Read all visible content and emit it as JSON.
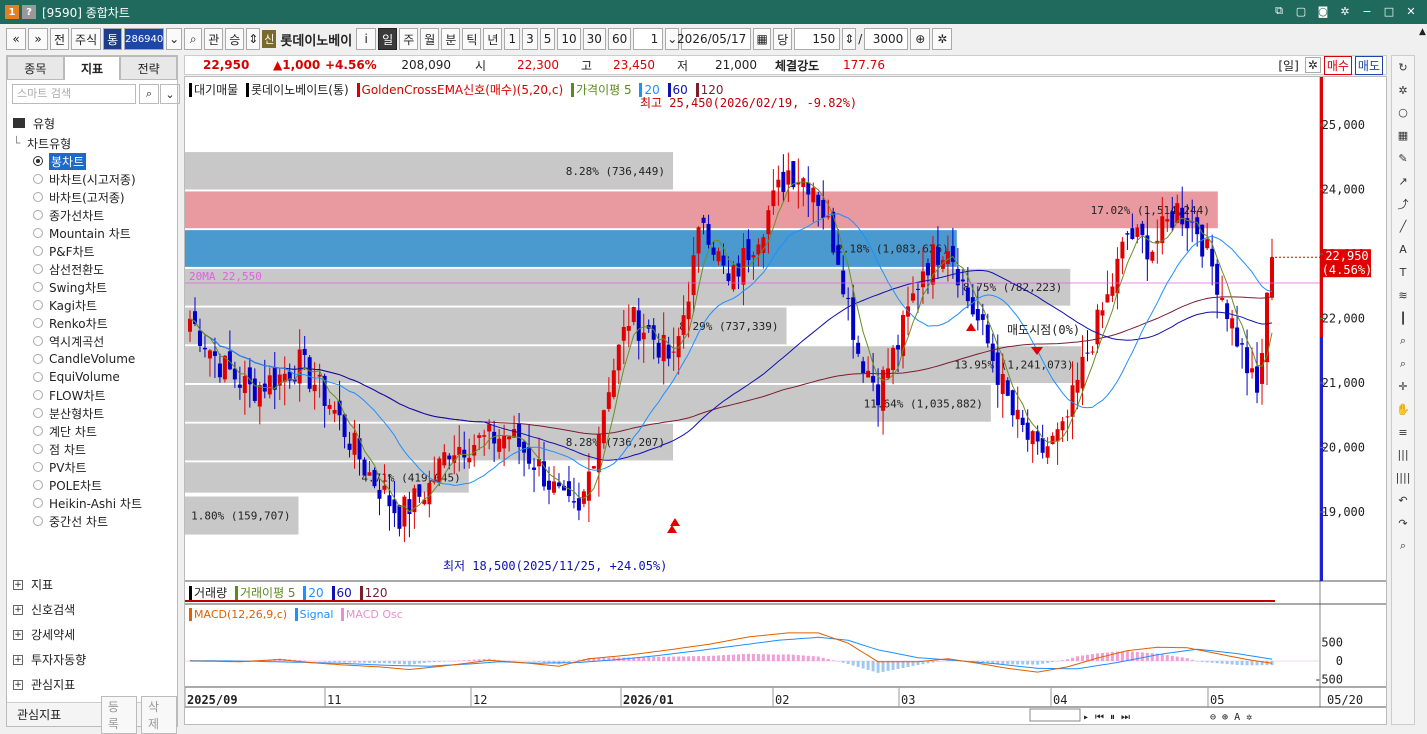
{
  "window": {
    "title": "[9590] 종합차트",
    "icon1": "1",
    "icon2": "?"
  },
  "toolbar": {
    "prev": "«",
    "next": "»",
    "btn_front": "전",
    "btn_stock": "주식",
    "btn_tong": "통",
    "code": "286940",
    "btn_gwan": "관",
    "btn_seung": "승",
    "shin": "신",
    "stock_name": "롯데이노베이",
    "info": "i",
    "periods": [
      "일",
      "주",
      "월",
      "분",
      "틱",
      "년"
    ],
    "counts": [
      "1",
      "3",
      "5",
      "10",
      "30",
      "60"
    ],
    "count_value": "1",
    "date": "2026/05/17",
    "dang": "당",
    "qty": "150",
    "slash": "/",
    "total": "3000"
  },
  "left_panel": {
    "tabs": [
      "종목",
      "지표",
      "전략"
    ],
    "active_tab": "지표",
    "search_placeholder": "스마트 검색",
    "type_group": "유형",
    "chart_type_group": "차트유형",
    "chart_types": [
      "봉차트",
      "바차트(시고저종)",
      "바차트(고저종)",
      "종가선차트",
      "Mountain 차트",
      "P&F차트",
      "삼선전환도",
      "Swing차트",
      "Kagi차트",
      "Renko차트",
      "역시계곡선",
      "CandleVolume",
      "EquiVolume",
      "FLOW차트",
      "분산형차트",
      "계단 차트",
      "점 차트",
      "PV차트",
      "POLE차트",
      "Heikin-Ashi 차트",
      "중간선 차트"
    ],
    "selected_type": "봉차트",
    "groups": [
      "지표",
      "신호검색",
      "강세약세",
      "투자자동향",
      "관심지표"
    ],
    "fav_label": "관심지표",
    "fav_reg": "등록",
    "fav_del": "삭제"
  },
  "price_bar": {
    "price": "22,950",
    "change": "▲1,000",
    "pct": "+4.56%",
    "volume": "208,090",
    "open_label": "시",
    "open": "22,300",
    "high_label": "고",
    "high": "23,450",
    "low_label": "저",
    "low": "21,000",
    "strength_label": "체결강도",
    "strength": "177.76",
    "period_label": "[일]",
    "buy": "매수",
    "sell": "매도"
  },
  "legend": {
    "main": [
      "대기매물",
      "롯데이노베이트(통)",
      "GoldenCrossEMA신호(매수)(5,20,c)",
      "가격이평 5",
      "20",
      "60",
      "120"
    ],
    "volume": [
      "거래량",
      "거래이평 5",
      "20",
      "60",
      "120"
    ],
    "macd": [
      "MACD(12,26,9,c)",
      "Signal",
      "MACD Osc"
    ]
  },
  "colors": {
    "up": "#e00000",
    "down": "#0000c8",
    "ma5": "#6b8e23",
    "ma20": "#1e90ff",
    "ma60": "#1010b0",
    "ma120": "#7b1e2e",
    "accent_title": "#1f6a5d"
  },
  "annotations": {
    "high_note": "최고 25,450(2026/02/19, -9.82%)",
    "low_note": "최저 18,500(2025/11/25, +24.05%)",
    "ma_note": "20MA 22,550",
    "ma_note_value": 22550,
    "current_price": "22,950",
    "current_pct": "(4.56%)",
    "current_value": 22950,
    "sell_signal": "매도시점(0%)"
  },
  "chart_data": {
    "type": "candlestick",
    "price_ticks": [
      "25,000",
      "24,000",
      "23,000",
      "22,000",
      "21,000",
      "20,000",
      "19,000"
    ],
    "price_tick_values": [
      25000,
      24000,
      23000,
      22000,
      21000,
      20000,
      19000
    ],
    "x_labels": [
      "2025/09",
      "11",
      "12",
      "2026/01",
      "02",
      "03",
      "04",
      "05",
      "05/20"
    ],
    "supply_zones": [
      {
        "label": "8.28% (736,449)",
        "lo": 24000,
        "hi": 24580,
        "pct": 0.43,
        "color": "gray"
      },
      {
        "label": "17.02% (1,514,244)",
        "lo": 23400,
        "hi": 23970,
        "pct": 0.91,
        "color": "red"
      },
      {
        "label": "12.18% (1,083,626)",
        "lo": 22800,
        "hi": 23370,
        "pct": 0.68,
        "color": "blue"
      },
      {
        "label": "8.75% (782,223)",
        "lo": 22200,
        "hi": 22770,
        "pct": 0.78,
        "color": "gray"
      },
      {
        "label": "8.29% (737,339)",
        "lo": 21600,
        "hi": 22170,
        "pct": 0.53,
        "color": "gray"
      },
      {
        "label": "13.95% (1,241,073)",
        "lo": 21000,
        "hi": 21570,
        "pct": 0.79,
        "color": "gray"
      },
      {
        "label": "11.64% (1,035,882)",
        "lo": 20400,
        "hi": 20970,
        "pct": 0.71,
        "color": "gray"
      },
      {
        "label": "8.28% (736,207)",
        "lo": 19800,
        "hi": 20370,
        "pct": 0.43,
        "color": "gray"
      },
      {
        "label": "4.71% (419,045)",
        "lo": 19300,
        "hi": 19770,
        "pct": 0.25,
        "color": "gray"
      },
      {
        "label": "1.80% (159,707)",
        "lo": 18650,
        "hi": 19240,
        "pct": 0.1,
        "color": "gray"
      }
    ],
    "macd_ticks": [
      "500",
      "0",
      "-500"
    ],
    "macd_tick_values": [
      500,
      0,
      -500
    ],
    "close_anchors": [
      [
        0,
        22000
      ],
      [
        6,
        21300
      ],
      [
        12,
        20900
      ],
      [
        18,
        21100
      ],
      [
        22,
        21300
      ],
      [
        28,
        20700
      ],
      [
        35,
        19700
      ],
      [
        42,
        18950
      ],
      [
        48,
        19400
      ],
      [
        52,
        20000
      ],
      [
        58,
        20100
      ],
      [
        64,
        20200
      ],
      [
        70,
        19700
      ],
      [
        75,
        19100
      ],
      [
        78,
        18900
      ],
      [
        84,
        21000
      ],
      [
        88,
        22000
      ],
      [
        92,
        21800
      ],
      [
        97,
        21300
      ],
      [
        103,
        23600
      ],
      [
        108,
        22500
      ],
      [
        115,
        23500
      ],
      [
        120,
        24300
      ],
      [
        125,
        24100
      ],
      [
        130,
        23000
      ],
      [
        134,
        21500
      ],
      [
        138,
        20900
      ],
      [
        142,
        21600
      ],
      [
        147,
        22800
      ],
      [
        152,
        23200
      ],
      [
        156,
        22300
      ],
      [
        160,
        21600
      ],
      [
        165,
        20500
      ],
      [
        170,
        19900
      ],
      [
        175,
        20200
      ],
      [
        180,
        21500
      ],
      [
        184,
        22300
      ],
      [
        188,
        23300
      ],
      [
        193,
        23100
      ],
      [
        198,
        23700
      ],
      [
        202,
        23400
      ],
      [
        206,
        22600
      ],
      [
        210,
        21700
      ],
      [
        214,
        20800
      ],
      [
        217,
        22950
      ]
    ],
    "macd_anchors": [
      [
        0,
        0
      ],
      [
        6,
        -10
      ],
      [
        10,
        -20
      ],
      [
        18,
        40
      ],
      [
        24,
        -40
      ],
      [
        30,
        -100
      ],
      [
        38,
        -160
      ],
      [
        44,
        -230
      ],
      [
        52,
        -120
      ],
      [
        60,
        20
      ],
      [
        68,
        -60
      ],
      [
        74,
        -140
      ],
      [
        80,
        60
      ],
      [
        88,
        160
      ],
      [
        96,
        300
      ],
      [
        104,
        450
      ],
      [
        112,
        650
      ],
      [
        120,
        760
      ],
      [
        126,
        760
      ],
      [
        132,
        480
      ],
      [
        138,
        -20
      ],
      [
        146,
        -20
      ],
      [
        152,
        60
      ],
      [
        158,
        -60
      ],
      [
        164,
        -200
      ],
      [
        170,
        -300
      ],
      [
        176,
        -160
      ],
      [
        182,
        80
      ],
      [
        188,
        280
      ],
      [
        194,
        370
      ],
      [
        200,
        360
      ],
      [
        206,
        200
      ],
      [
        212,
        40
      ],
      [
        217,
        -60
      ]
    ],
    "signal_anchors": [
      [
        0,
        10
      ],
      [
        10,
        0
      ],
      [
        20,
        -30
      ],
      [
        30,
        -60
      ],
      [
        40,
        -120
      ],
      [
        48,
        -140
      ],
      [
        56,
        -80
      ],
      [
        62,
        -20
      ],
      [
        70,
        -60
      ],
      [
        78,
        -40
      ],
      [
        86,
        40
      ],
      [
        94,
        150
      ],
      [
        102,
        280
      ],
      [
        110,
        420
      ],
      [
        118,
        560
      ],
      [
        126,
        640
      ],
      [
        132,
        560
      ],
      [
        138,
        300
      ],
      [
        146,
        90
      ],
      [
        154,
        10
      ],
      [
        162,
        -80
      ],
      [
        170,
        -200
      ],
      [
        178,
        -210
      ],
      [
        186,
        -40
      ],
      [
        194,
        170
      ],
      [
        202,
        320
      ],
      [
        210,
        200
      ],
      [
        217,
        50
      ]
    ]
  }
}
